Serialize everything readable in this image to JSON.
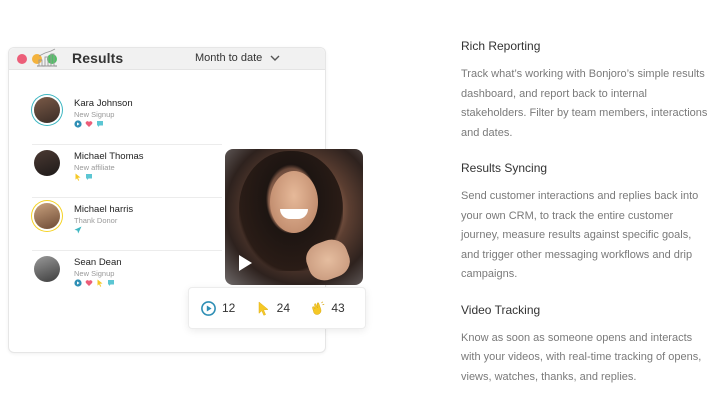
{
  "results": {
    "title": "Results",
    "range": "Month to date"
  },
  "people": [
    {
      "name": "Kara Johnson",
      "status": "New Signup",
      "tags": [
        "play",
        "heart",
        "chat"
      ]
    },
    {
      "name": "Michael Thomas",
      "status": "New affiliate",
      "tags": [
        "cursor",
        "chat"
      ]
    },
    {
      "name": "Michael harris",
      "status": "Thank Donor",
      "tags": [
        "send"
      ]
    },
    {
      "name": "Sean Dean",
      "status": "New Signup",
      "tags": [
        "play",
        "heart",
        "cursor",
        "chat"
      ]
    }
  ],
  "stats": {
    "plays": "12",
    "clicks": "24",
    "thanks": "43"
  },
  "colors": {
    "teal": "#3fb7c2",
    "pink": "#ec5e79",
    "yellow": "#f5c826",
    "blue_play": "#2f8fb5"
  },
  "features": [
    {
      "title": "Rich Reporting",
      "body": "Track what’s working with Bonjoro’s simple results dashboard, and report back to internal stakeholders. Filter by team members, interactions and dates."
    },
    {
      "title": "Results Syncing",
      "body": "Send customer interactions and replies back into your own CRM, to track the entire customer journey, measure results against specific goals, and trigger other messaging workflows and drip campaigns."
    },
    {
      "title": "Video Tracking",
      "body": "Know as soon as someone opens and interacts with your videos, with real-time tracking of opens, views, watches, thanks, and replies."
    }
  ]
}
